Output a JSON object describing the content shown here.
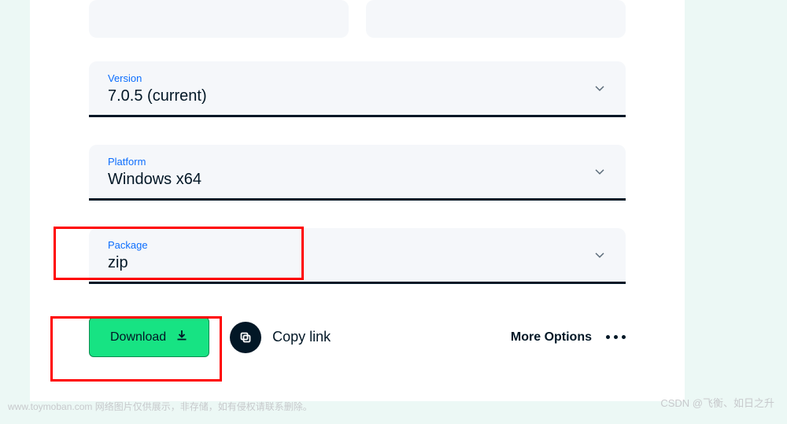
{
  "dropdowns": {
    "version": {
      "label": "Version",
      "value": "7.0.5 (current)"
    },
    "platform": {
      "label": "Platform",
      "value": "Windows x64"
    },
    "package": {
      "label": "Package",
      "value": "zip"
    }
  },
  "actions": {
    "download": "Download",
    "copylink": "Copy link",
    "more": "More Options"
  },
  "watermark": {
    "left": "www.toymoban.com 网络图片仅供展示，非存储，如有侵权请联系删除。",
    "right": "CSDN @飞衡、如日之升"
  }
}
